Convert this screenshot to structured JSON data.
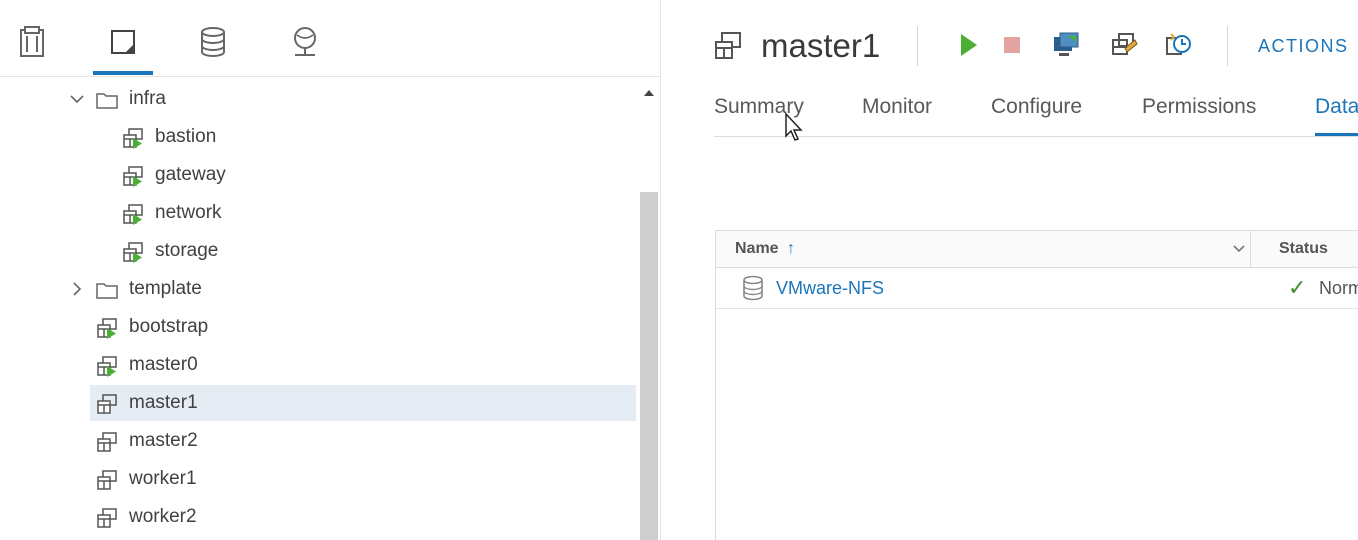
{
  "navigator": {
    "tabs": [
      {
        "icon": "hosts-clusters-icon",
        "active": false
      },
      {
        "icon": "vms-templates-icon",
        "active": true
      },
      {
        "icon": "storage-icon",
        "active": false
      },
      {
        "icon": "networking-icon",
        "active": false
      }
    ],
    "tree": [
      {
        "label": "infra",
        "type": "folder",
        "expanded": true,
        "level": 0
      },
      {
        "label": "bastion",
        "type": "vm-on",
        "level": 1
      },
      {
        "label": "gateway",
        "type": "vm-on",
        "level": 1
      },
      {
        "label": "network",
        "type": "vm-on",
        "level": 1
      },
      {
        "label": "storage",
        "type": "vm-on",
        "level": 1
      },
      {
        "label": "template",
        "type": "folder",
        "expanded": false,
        "level": 0
      },
      {
        "label": "bootstrap",
        "type": "vm-on",
        "level": 0
      },
      {
        "label": "master0",
        "type": "vm-on",
        "level": 0
      },
      {
        "label": "master1",
        "type": "vm-off",
        "level": 0,
        "selected": true
      },
      {
        "label": "master2",
        "type": "vm-off",
        "level": 0
      },
      {
        "label": "worker1",
        "type": "vm-off",
        "level": 0
      },
      {
        "label": "worker2",
        "type": "vm-off",
        "level": 0
      }
    ]
  },
  "object": {
    "title": "master1",
    "icon": "virtual-machine-icon",
    "toolbar": [
      {
        "icon": "power-on-icon"
      },
      {
        "icon": "power-off-icon"
      },
      {
        "icon": "launch-console-icon"
      },
      {
        "icon": "migrate-icon"
      },
      {
        "icon": "snapshot-icon"
      }
    ],
    "actions_label": "ACTIONS"
  },
  "tabs": [
    {
      "label": "Summary",
      "active": false
    },
    {
      "label": "Monitor",
      "active": false
    },
    {
      "label": "Configure",
      "active": false
    },
    {
      "label": "Permissions",
      "active": false
    },
    {
      "label": "Datastores",
      "active": true
    }
  ],
  "grid": {
    "columns": [
      {
        "label": "Name",
        "sort": "ascending",
        "sort_glyph": "↑"
      },
      {
        "label": "Status"
      }
    ],
    "rows": [
      {
        "name": "VMware-NFS",
        "icon": "datastore-icon",
        "status_glyph": "✓",
        "status": "Normal"
      }
    ]
  },
  "colors": {
    "accent": "#1b75bb",
    "vm_on": "#4caf35",
    "selected_row": "#e6ecf3",
    "stop": "#e2a3a3"
  }
}
